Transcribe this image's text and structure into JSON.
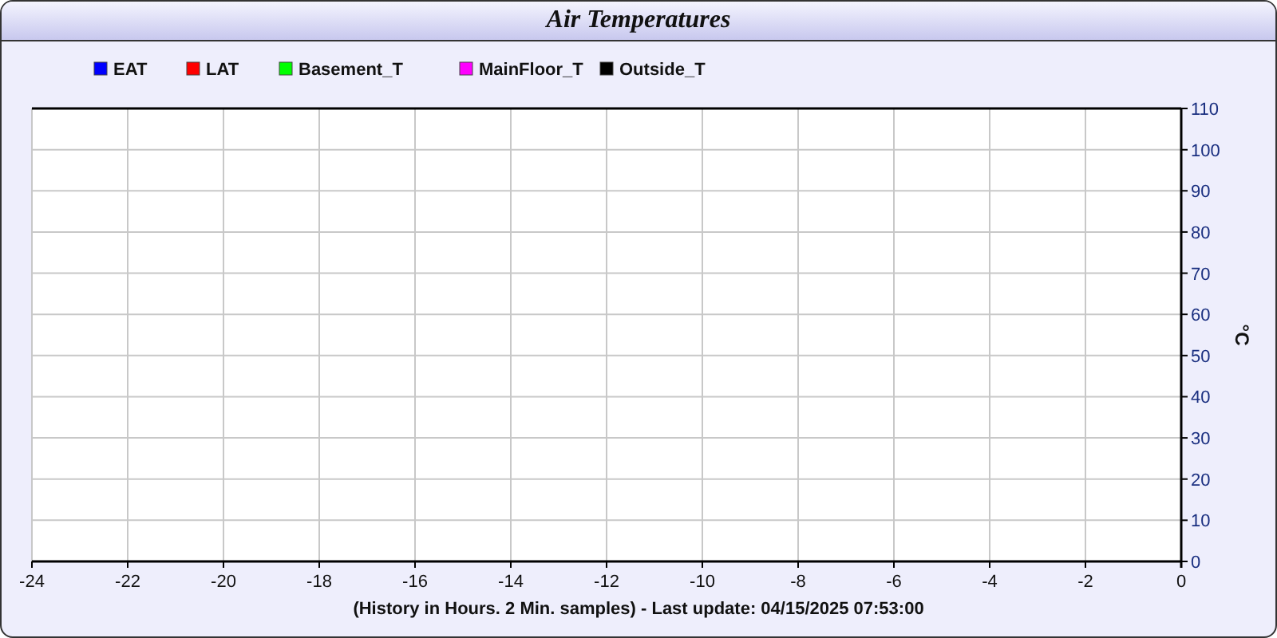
{
  "title": "Air Temperatures",
  "chart_data": {
    "type": "line",
    "series": [
      {
        "name": "EAT",
        "color": "#0000ff",
        "values": [
          null,
          null,
          null,
          null,
          null,
          null,
          null,
          null,
          null,
          null,
          null,
          null,
          null
        ]
      },
      {
        "name": "LAT",
        "color": "#ff0000",
        "values": [
          null,
          null,
          null,
          null,
          null,
          null,
          null,
          null,
          null,
          null,
          null,
          null,
          null
        ]
      },
      {
        "name": "Basement_T",
        "color": "#00ff00",
        "values": [
          null,
          null,
          null,
          null,
          null,
          null,
          null,
          null,
          null,
          null,
          null,
          null,
          null
        ]
      },
      {
        "name": "MainFloor_T",
        "color": "#ff00ff",
        "values": [
          null,
          null,
          null,
          null,
          null,
          null,
          null,
          null,
          null,
          null,
          null,
          null,
          null
        ]
      },
      {
        "name": "Outside_T",
        "color": "#000000",
        "values": [
          null,
          null,
          null,
          null,
          null,
          null,
          null,
          null,
          null,
          null,
          null,
          null,
          null
        ]
      }
    ],
    "categories": [
      "-24",
      "-22",
      "-20",
      "-18",
      "-16",
      "-14",
      "-12",
      "-10",
      "-8",
      "-6",
      "-4",
      "-2",
      "0"
    ],
    "ylim": [
      0,
      110
    ],
    "grid": true,
    "yticks": [
      0,
      10,
      20,
      30,
      40,
      50,
      60,
      70,
      80,
      90,
      100,
      110
    ],
    "ylabel": "°C",
    "xlabel": "(History in Hours. 2 Min. samples) - Last update: 04/15/2025 07:53:00"
  }
}
